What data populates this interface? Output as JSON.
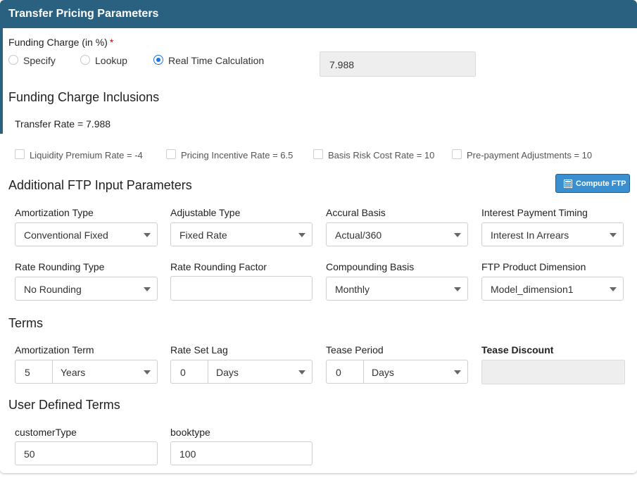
{
  "header": {
    "title": "Transfer Pricing Parameters"
  },
  "funding_charge": {
    "label": "Funding Charge (in %)",
    "required_mark": "*",
    "options": [
      "Specify",
      "Lookup",
      "Real Time Calculation"
    ],
    "selected": "Real Time Calculation",
    "value": "7.988"
  },
  "inclusions": {
    "title": "Funding Charge Inclusions",
    "transfer_rate": "Transfer Rate = 7.988",
    "checks": [
      {
        "label": "Liquidity Premium Rate = -4",
        "checked": false
      },
      {
        "label": "Pricing Incentive Rate = 6.5",
        "checked": false
      },
      {
        "label": "Basis Risk Cost Rate = 10",
        "checked": false
      },
      {
        "label": "Pre-payment Adjustments = 10",
        "checked": false
      }
    ]
  },
  "additional": {
    "title": "Additional FTP Input Parameters",
    "compute_button": "Compute FTP",
    "fields": [
      {
        "label": "Amortization Type",
        "value": "Conventional Fixed"
      },
      {
        "label": "Adjustable Type",
        "value": "Fixed Rate"
      },
      {
        "label": "Accural Basis",
        "value": "Actual/360"
      },
      {
        "label": "Interest Payment Timing",
        "value": "Interest In Arrears"
      },
      {
        "label": "Rate Rounding Type",
        "value": "No Rounding"
      },
      {
        "label": "Rate Rounding Factor",
        "value": ""
      },
      {
        "label": "Compounding Basis",
        "value": "Monthly"
      },
      {
        "label": "FTP Product Dimension",
        "value": "Model_dimension1"
      }
    ]
  },
  "terms": {
    "title": "Terms",
    "amortization_term": {
      "label": "Amortization Term",
      "number": "5",
      "unit": "Years"
    },
    "rate_set_lag": {
      "label": "Rate Set Lag",
      "number": "0",
      "unit": "Days"
    },
    "tease_period": {
      "label": "Tease Period",
      "number": "0",
      "unit": "Days"
    },
    "tease_discount": {
      "label": "Tease Discount",
      "value": ""
    }
  },
  "user_defined": {
    "title": "User Defined Terms",
    "fields": [
      {
        "label": "customerType",
        "value": "50"
      },
      {
        "label": "booktype",
        "value": "100"
      }
    ]
  },
  "colors": {
    "header": "#2a6080",
    "button": "#3a8fd0",
    "radio_selected": "#1a73e8",
    "required": "#dd0000"
  }
}
